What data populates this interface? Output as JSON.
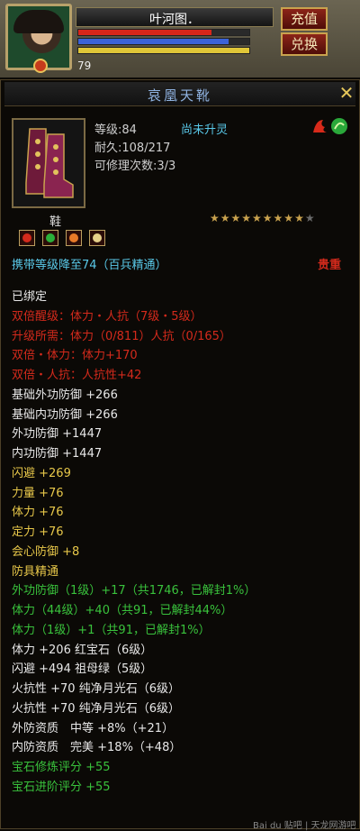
{
  "character": {
    "name": "叶河图．",
    "level": "79",
    "hp_fraction": 0.78,
    "mp_fraction": 0.88,
    "rage_fraction": 1.0
  },
  "top_buttons": {
    "recharge": "充值",
    "exchange": "兑换"
  },
  "item": {
    "name": "哀凰天靴",
    "level_line": "等级:84",
    "durability_line": "耐久:108/217",
    "repair_line": "可修理次数:3/3",
    "upgrade_status": "尚未升灵",
    "type": "鞋",
    "stars_filled": 9,
    "stars_total": 10,
    "stars_filled_glyph": "★★★★★★★★★",
    "stars_empty_glyph": "★",
    "req_line": "携带等级降至74（百兵精通）",
    "rarity": "贵重"
  },
  "colors": {
    "white": "#e8e8e8",
    "red": "#d42a1c",
    "green": "#39c23c",
    "gold": "#e8c84a",
    "blue_title": "#8fb2e0",
    "cyan": "#59c8e8",
    "hp": "#d8261a",
    "mp": "#3b62d8",
    "rage": "#e0c638"
  },
  "attributes": [
    {
      "text": "已绑定",
      "color": "white"
    },
    {
      "text": "双倍醒级：体力・人抗（7级・5级）",
      "color": "red"
    },
    {
      "text": "升级所需：体力（0/811）人抗（0/165）",
      "color": "red"
    },
    {
      "text": "双倍・体力：体力+170",
      "color": "red"
    },
    {
      "text": "双倍・人抗：人抗性+42",
      "color": "red"
    },
    {
      "text": "基础外功防御 +266",
      "color": "white"
    },
    {
      "text": "基础内功防御 +266",
      "color": "white"
    },
    {
      "text": "外功防御 +1447",
      "color": "white"
    },
    {
      "text": "内功防御 +1447",
      "color": "white"
    },
    {
      "text": "闪避 +269",
      "color": "gold"
    },
    {
      "text": "力量 +76",
      "color": "gold"
    },
    {
      "text": "体力 +76",
      "color": "gold"
    },
    {
      "text": "定力 +76",
      "color": "gold"
    },
    {
      "text": "会心防御 +8",
      "color": "gold"
    },
    {
      "text": "防具精通",
      "color": "gold"
    },
    {
      "text": "外功防御（1级）+17（共1746，已解封1%）",
      "color": "green"
    },
    {
      "text": "体力（44级）+40（共91，已解封44%）",
      "color": "green"
    },
    {
      "text": "体力（1级）+1（共91，已解封1%）",
      "color": "green"
    },
    {
      "text": "体力 +206 红宝石（6级）",
      "color": "white"
    },
    {
      "text": "闪避 +494 祖母绿（5级）",
      "color": "white"
    },
    {
      "text": "火抗性 +70 纯净月光石（6级）",
      "color": "white"
    },
    {
      "text": "火抗性 +70 纯净月光石（6级）",
      "color": "white"
    },
    {
      "text": "外防资质　中等 +8%（+21）",
      "color": "white"
    },
    {
      "text": "内防资质　完美 +18%（+48）",
      "color": "white"
    },
    {
      "text": "宝石修炼评分 +55",
      "color": "green"
    },
    {
      "text": "宝石进阶评分 +55",
      "color": "green"
    }
  ],
  "footer": "Bai du 贴吧 | 天龙网游吧"
}
